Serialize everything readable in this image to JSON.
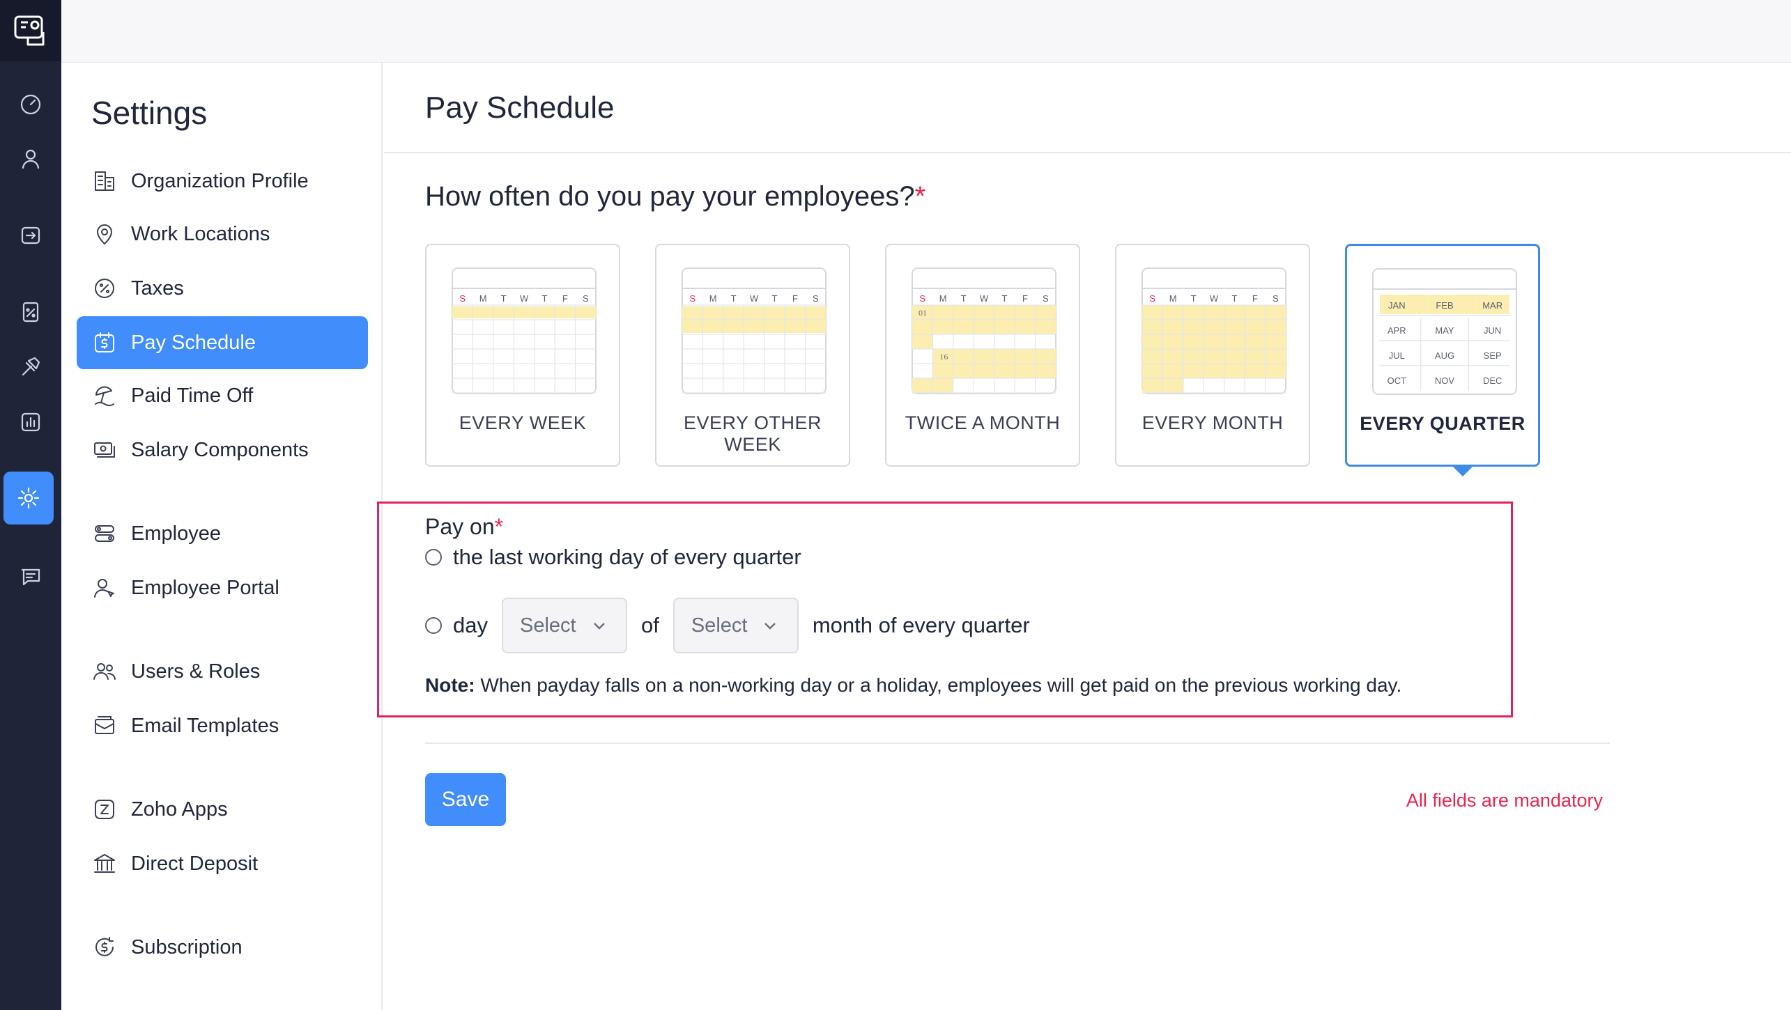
{
  "sidebar": {
    "title": "Settings",
    "items": [
      {
        "label": "Organization Profile",
        "icon": "building-icon"
      },
      {
        "label": "Work Locations",
        "icon": "location-pin-icon"
      },
      {
        "label": "Taxes",
        "icon": "percent-badge-icon"
      },
      {
        "label": "Pay Schedule",
        "icon": "dollar-calendar-icon",
        "active": true
      },
      {
        "label": "Paid Time Off",
        "icon": "beach-umbrella-icon"
      },
      {
        "label": "Salary Components",
        "icon": "money-stack-icon"
      },
      {
        "label": "Employee",
        "icon": "toggle-list-icon"
      },
      {
        "label": "Employee Portal",
        "icon": "user-portal-icon"
      },
      {
        "label": "Users & Roles",
        "icon": "users-icon"
      },
      {
        "label": "Email Templates",
        "icon": "mail-template-icon"
      },
      {
        "label": "Zoho Apps",
        "icon": "zoho-z-icon"
      },
      {
        "label": "Direct Deposit",
        "icon": "bank-icon"
      },
      {
        "label": "Subscription",
        "icon": "dollar-cycle-icon"
      }
    ]
  },
  "rail": {
    "icons": [
      "app-logo-icon",
      "dashboard-gauge-icon",
      "person-icon",
      "pay-run-icon",
      "tax-document-icon",
      "approvals-hammer-icon",
      "reports-chart-icon",
      "settings-gear-icon",
      "chat-icon"
    ],
    "active": "settings-gear-icon"
  },
  "main": {
    "page_title": "Pay Schedule",
    "question": "How often do you pay your employees?",
    "required_mark": "*",
    "frequencies": [
      {
        "label": "EVERY WEEK",
        "selected": false
      },
      {
        "label": "EVERY OTHER WEEK",
        "selected": false
      },
      {
        "label": "TWICE A MONTH",
        "selected": false
      },
      {
        "label": "EVERY MONTH",
        "selected": false
      },
      {
        "label": "EVERY QUARTER",
        "selected": true
      }
    ],
    "calendar": {
      "weekdays": [
        "S",
        "M",
        "T",
        "W",
        "T",
        "F",
        "S"
      ],
      "twice_month_days": [
        "01",
        "16"
      ],
      "months": [
        "JAN",
        "FEB",
        "MAR",
        "APR",
        "MAY",
        "JUN",
        "JUL",
        "AUG",
        "SEP",
        "OCT",
        "NOV",
        "DEC"
      ]
    },
    "pay_on": {
      "title": "Pay on",
      "option1": "the last working day of every quarter",
      "option2_prefix": "day",
      "select1": "Select",
      "of_text": "of",
      "select2": "Select",
      "option2_suffix": "month of every quarter",
      "note_label": "Note:",
      "note_text": " When payday falls on a non-working day or a holiday, employees will get paid on the previous working day."
    },
    "save_label": "Save",
    "mandatory_text": "All fields are mandatory"
  },
  "colors": {
    "accent": "#408dfb",
    "rail_bg": "#1f2438",
    "highlight_cell": "#fbeeb0",
    "error_red": "#e8254e"
  }
}
